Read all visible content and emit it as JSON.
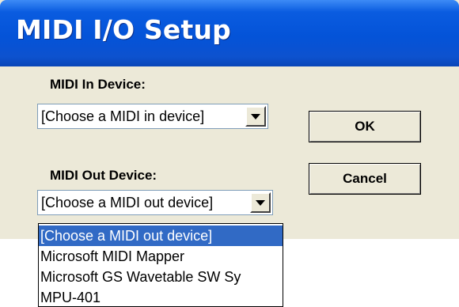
{
  "window": {
    "title": "MIDI I/O Setup"
  },
  "midi_in": {
    "label": "MIDI In Device:",
    "value": "[Choose a MIDI in device]"
  },
  "midi_out": {
    "label": "MIDI Out Device:",
    "value": "[Choose a MIDI out device]",
    "options": [
      "[Choose a MIDI out device]",
      "Microsoft MIDI Mapper",
      "Microsoft GS Wavetable SW Sy",
      "MPU-401"
    ],
    "selected_index": 0
  },
  "buttons": {
    "ok": "OK",
    "cancel": "Cancel"
  },
  "colors": {
    "titlebar": "#0453d8",
    "dialog_bg": "#ece9d8",
    "selection": "#316ac5"
  }
}
